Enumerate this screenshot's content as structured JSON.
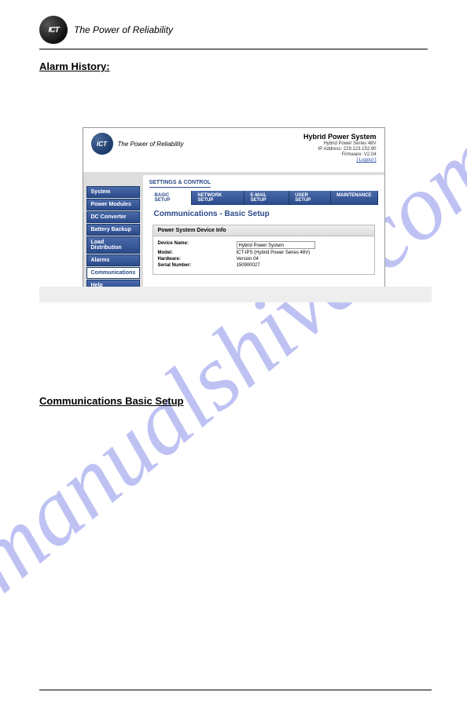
{
  "watermark": "manualshive.com",
  "header": {
    "logo_text": "ICT",
    "tagline": "The Power of Reliability"
  },
  "section1": {
    "heading": "Alarm History:"
  },
  "screenshot": {
    "header": {
      "logo_text": "ICT",
      "tagline": "The Power of Reliability",
      "title": "Hybrid Power System",
      "sub1": "Hybrid Power Series 48V",
      "sub2": "IP Address: 229.123.152.90",
      "sub3": "Firmware: V2.04",
      "logout": "[ Logout ]"
    },
    "sidebar": {
      "items": [
        {
          "label": "System"
        },
        {
          "label": "Power Modules"
        },
        {
          "label": "DC Converter"
        },
        {
          "label": "Battery Backup"
        },
        {
          "label": "Load Distribution"
        },
        {
          "label": "Alarms"
        },
        {
          "label": "Communications"
        },
        {
          "label": "Help"
        }
      ]
    },
    "main": {
      "section_label": "SETTINGS & CONTROL",
      "tabs": [
        {
          "label": "BASIC SETUP"
        },
        {
          "label": "NETWORK SETUP"
        },
        {
          "label": "E-MAIL SETUP"
        },
        {
          "label": "USER SETUP"
        },
        {
          "label": "MAINTENANCE"
        }
      ],
      "page_title": "Communications - Basic Setup",
      "panel_title": "Power System Device Info",
      "rows": [
        {
          "label": "Device Name:",
          "value": "Hybrid Power System",
          "input": true
        },
        {
          "label": "Model:",
          "value": "ICT-IPS (Hybrid Power Series 48V)"
        },
        {
          "label": "Hardware:",
          "value": "Version 04"
        },
        {
          "label": "Serial Number:",
          "value": "150900027"
        }
      ]
    }
  },
  "section2": {
    "heading": "Communications Basic Setup"
  }
}
